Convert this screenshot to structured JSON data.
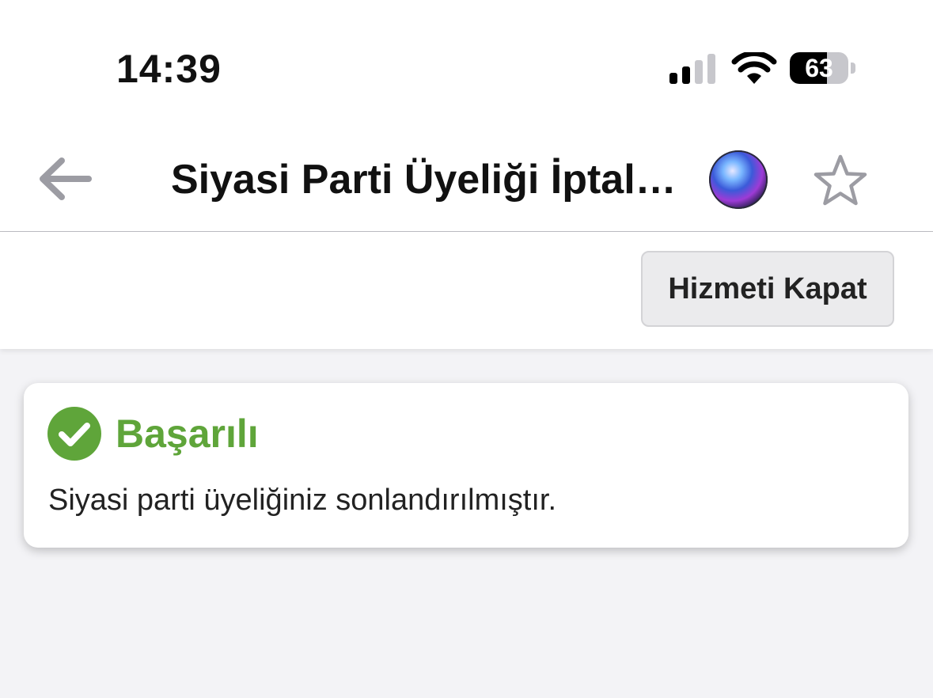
{
  "status_bar": {
    "time": "14:39",
    "battery_percent": "63",
    "battery_level": 0.63,
    "signal_bars_active": 2,
    "icons": [
      "cellular-signal-icon",
      "wifi-icon",
      "battery-icon"
    ]
  },
  "nav": {
    "title": "Siyasi Parti Üyeliği İptal…",
    "icons": [
      "back-arrow-icon",
      "siri-icon",
      "star-icon"
    ]
  },
  "toolbar": {
    "close_service_label": "Hizmeti Kapat"
  },
  "result": {
    "title": "Başarılı",
    "message": "Siyasi parti üyeliğiniz sonlandırılmıştır.",
    "icon": "check-circle-icon"
  },
  "colors": {
    "success": "#5fa53a",
    "background": "#f3f3f6",
    "icon_gray": "#9c9ca3"
  }
}
